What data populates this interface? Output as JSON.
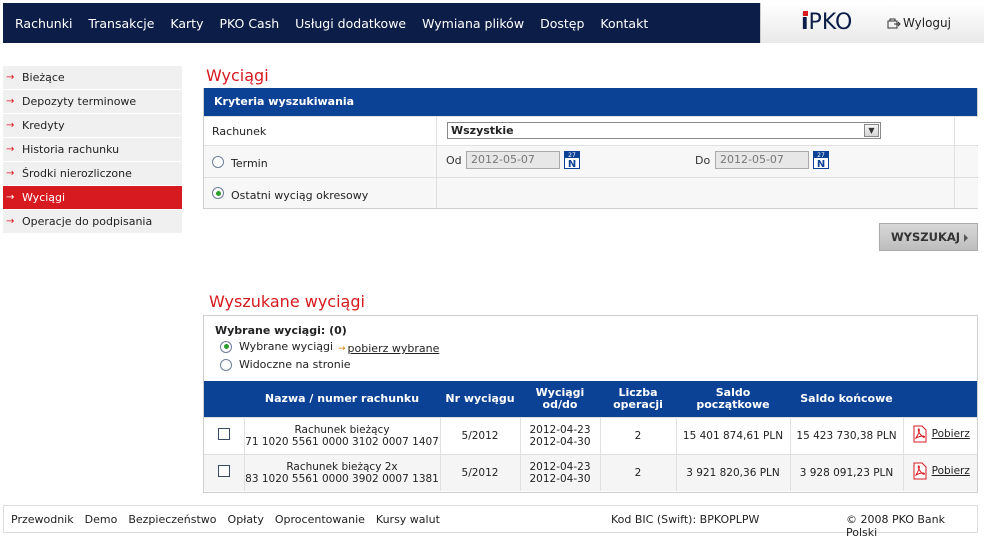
{
  "nav": {
    "items": [
      "Rachunki",
      "Transakcje",
      "Karty",
      "PKO Cash",
      "Usługi dodatkowe",
      "Wymiana plików",
      "Dostęp",
      "Kontakt"
    ]
  },
  "brand": {
    "logo_i": "i",
    "logo_text": "PKO",
    "logout_label": "Wyloguj"
  },
  "sidebar": {
    "items": [
      {
        "label": "Bieżące"
      },
      {
        "label": "Depozyty terminowe"
      },
      {
        "label": "Kredyty"
      },
      {
        "label": "Historia rachunku"
      },
      {
        "label": "Środki nierozliczone"
      },
      {
        "label": "Wyciągi"
      },
      {
        "label": "Operacje do podpisania"
      }
    ],
    "active_index": 5
  },
  "search": {
    "page_title": "Wyciągi",
    "panel_title": "Kryteria wyszukiwania",
    "account_label": "Rachunek",
    "account_value": "Wszystkie",
    "term_label": "Termin",
    "from_label": "Od",
    "from_value": "2012-05-07",
    "to_label": "Do",
    "to_value": "2012-05-07",
    "last_label": "Ostatni wyciąg okresowy",
    "selected_option": "last",
    "cal_top": "27",
    "cal_letter": "N",
    "button_label": "WYSZUKAJ"
  },
  "results": {
    "title": "Wyszukane wyciągi",
    "selected_title": "Wybrane wyciągi: (0)",
    "opt_selected": "Wybrane wyciągi",
    "opt_visible": "Widoczne na stronie",
    "download_selected": "pobierz wybrane",
    "columns": [
      "Nazwa / numer rachunku",
      "Nr wyciągu",
      "Wyciągi od/do",
      "Liczba operacji",
      "Saldo początkowe",
      "Saldo końcowe"
    ],
    "rows": [
      {
        "name": "Rachunek bieżący",
        "number": "71 1020 5561 0000 3102 0007 1407",
        "statement_no": "5/2012",
        "date_from": "2012-04-23",
        "date_to": "2012-04-30",
        "operations": "2",
        "opening_balance": "15 401 874,61 PLN",
        "closing_balance": "15 423 730,38 PLN",
        "download": "Pobierz"
      },
      {
        "name": "Rachunek bieżący 2x",
        "number": "83 1020 5561 0000 3902 0007 1381",
        "statement_no": "5/2012",
        "date_from": "2012-04-23",
        "date_to": "2012-04-30",
        "operations": "2",
        "opening_balance": "3 921 820,36 PLN",
        "closing_balance": "3 928 091,23 PLN",
        "download": "Pobierz"
      }
    ]
  },
  "footer": {
    "links": [
      "Przewodnik",
      "Demo",
      "Bezpieczeństwo",
      "Opłaty",
      "Oprocentowanie",
      "Kursy walut"
    ],
    "bic": "Kod BIC (Swift): BPKOPLPW",
    "copyright": "© 2008 PKO Bank Polski"
  },
  "colors": {
    "navy": "#0c1e48",
    "header_blue": "#0c4296",
    "accent_red": "#d71920"
  }
}
